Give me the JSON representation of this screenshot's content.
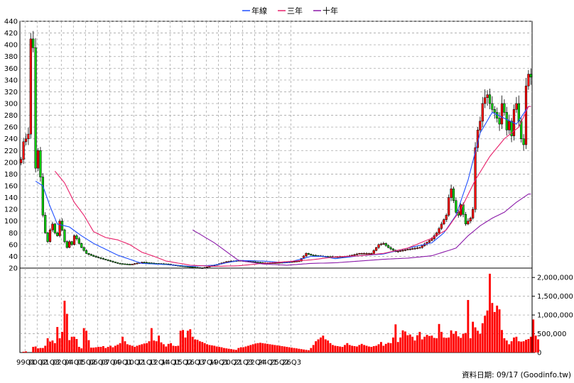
{
  "legend": [
    {
      "label": "年線",
      "color": "#1f4fff"
    },
    {
      "label": "三年",
      "color": "#e8206a"
    },
    {
      "label": "十年",
      "color": "#8a18a8"
    }
  ],
  "source_note": "資料日期: 09/17  (Goodinfo.tw)",
  "colors": {
    "up": "#ff0000",
    "down": "#00cc00",
    "volume": "#ff0000",
    "grid": "#a8a8a8",
    "frame": "#000000"
  },
  "chart_data": [
    {
      "type": "candlestick",
      "ylim": [
        20,
        440
      ],
      "yticks": [
        20,
        40,
        60,
        80,
        100,
        120,
        140,
        160,
        180,
        200,
        220,
        240,
        260,
        280,
        300,
        320,
        340,
        360,
        380,
        400,
        420,
        440
      ],
      "x_tick_labels": [
        "99Q1",
        "00Q2",
        "01Q3",
        "02Q4",
        "04Q1",
        "05Q2",
        "06Q3",
        "07Q4",
        "09Q1",
        "10Q2",
        "11Q3",
        "12Q4",
        "14Q1",
        "15Q2",
        "16Q3",
        "17Q4",
        "19Q1",
        "20Q2",
        "21Q3",
        "22Q4",
        "24Q1",
        "25Q2",
        "26Q3"
      ],
      "x_tick_every": 5,
      "grid": true,
      "legend_position": "top-center",
      "series": [
        {
          "name": "年線",
          "color": "#1f4fff",
          "x_start": 6,
          "y_start": 168,
          "anchors": [
            [
              6,
              168
            ],
            [
              9,
              160
            ],
            [
              12,
              125
            ],
            [
              15,
              95
            ],
            [
              20,
              90
            ],
            [
              25,
              75
            ],
            [
              30,
              62
            ],
            [
              40,
              42
            ],
            [
              50,
              28
            ],
            [
              60,
              26
            ],
            [
              70,
              23
            ],
            [
              80,
              25
            ],
            [
              90,
              33
            ],
            [
              100,
              32
            ],
            [
              110,
              29
            ],
            [
              120,
              40
            ],
            [
              125,
              40
            ],
            [
              130,
              36
            ],
            [
              140,
              41
            ],
            [
              150,
              44
            ],
            [
              160,
              54
            ],
            [
              170,
              63
            ],
            [
              175,
              80
            ],
            [
              180,
              110
            ],
            [
              185,
              170
            ],
            [
              190,
              250
            ],
            [
              195,
              285
            ],
            [
              200,
              275
            ],
            [
              205,
              265
            ],
            [
              210,
              295
            ]
          ]
        },
        {
          "name": "三年",
          "color": "#e8206a",
          "x_start": 14,
          "y_start": 185,
          "anchors": [
            [
              14,
              185
            ],
            [
              18,
              165
            ],
            [
              22,
              132
            ],
            [
              26,
              110
            ],
            [
              30,
              82
            ],
            [
              35,
              72
            ],
            [
              40,
              68
            ],
            [
              45,
              60
            ],
            [
              50,
              47
            ],
            [
              55,
              40
            ],
            [
              60,
              32
            ],
            [
              70,
              25
            ],
            [
              80,
              23
            ],
            [
              90,
              24
            ],
            [
              100,
              28
            ],
            [
              110,
              31
            ],
            [
              120,
              34
            ],
            [
              130,
              39
            ],
            [
              140,
              41
            ],
            [
              150,
              45
            ],
            [
              160,
              54
            ],
            [
              170,
              71
            ],
            [
              176,
              85
            ],
            [
              182,
              120
            ],
            [
              188,
              170
            ],
            [
              194,
              210
            ],
            [
              200,
              240
            ],
            [
              206,
              260
            ],
            [
              210,
              295
            ]
          ]
        },
        {
          "name": "十年",
          "color": "#8a18a8",
          "x_start": 71,
          "y_start": 85,
          "anchors": [
            [
              71,
              85
            ],
            [
              80,
              63
            ],
            [
              90,
              33
            ],
            [
              100,
              27
            ],
            [
              110,
              25
            ],
            [
              120,
              28
            ],
            [
              130,
              29
            ],
            [
              140,
              32
            ],
            [
              150,
              35
            ],
            [
              160,
              37
            ],
            [
              170,
              41
            ],
            [
              180,
              54
            ],
            [
              185,
              75
            ],
            [
              190,
              92
            ],
            [
              195,
              105
            ],
            [
              200,
              115
            ],
            [
              205,
              132
            ],
            [
              210,
              146
            ]
          ]
        }
      ],
      "candles": {
        "count": 212,
        "anchors": [
          [
            0,
            205
          ],
          [
            1,
            235
          ],
          [
            2,
            240
          ],
          [
            3,
            248
          ],
          [
            4,
            410
          ],
          [
            5,
            395
          ],
          [
            6,
            190
          ],
          [
            7,
            220
          ],
          [
            8,
            175
          ],
          [
            9,
            110
          ],
          [
            10,
            80
          ],
          [
            11,
            65
          ],
          [
            12,
            85
          ],
          [
            13,
            95
          ],
          [
            14,
            80
          ],
          [
            15,
            75
          ],
          [
            16,
            100
          ],
          [
            17,
            85
          ],
          [
            18,
            65
          ],
          [
            19,
            55
          ],
          [
            20,
            65
          ],
          [
            21,
            60
          ],
          [
            22,
            75
          ],
          [
            23,
            70
          ],
          [
            24,
            62
          ],
          [
            25,
            55
          ],
          [
            26,
            50
          ],
          [
            27,
            45
          ],
          [
            30,
            40
          ],
          [
            35,
            34
          ],
          [
            40,
            28
          ],
          [
            45,
            26
          ],
          [
            50,
            30
          ],
          [
            55,
            28
          ],
          [
            60,
            27
          ],
          [
            65,
            24
          ],
          [
            70,
            22
          ],
          [
            75,
            20
          ],
          [
            80,
            25
          ],
          [
            85,
            31
          ],
          [
            90,
            33
          ],
          [
            95,
            31
          ],
          [
            100,
            29
          ],
          [
            105,
            29
          ],
          [
            110,
            30
          ],
          [
            115,
            32
          ],
          [
            118,
            45
          ],
          [
            120,
            42
          ],
          [
            125,
            40
          ],
          [
            130,
            39
          ],
          [
            135,
            40
          ],
          [
            140,
            45
          ],
          [
            145,
            45
          ],
          [
            148,
            60
          ],
          [
            150,
            62
          ],
          [
            152,
            55
          ],
          [
            155,
            48
          ],
          [
            160,
            52
          ],
          [
            165,
            55
          ],
          [
            170,
            70
          ],
          [
            172,
            80
          ],
          [
            174,
            95
          ],
          [
            176,
            110
          ],
          [
            177,
            140
          ],
          [
            178,
            155
          ],
          [
            179,
            135
          ],
          [
            180,
            115
          ],
          [
            181,
            110
          ],
          [
            182,
            128
          ],
          [
            184,
            95
          ],
          [
            186,
            105
          ],
          [
            187,
            120
          ],
          [
            188,
            225
          ],
          [
            189,
            255
          ],
          [
            190,
            270
          ],
          [
            191,
            300
          ],
          [
            192,
            310
          ],
          [
            193,
            315
          ],
          [
            194,
            300
          ],
          [
            195,
            290
          ],
          [
            196,
            285
          ],
          [
            197,
            275
          ],
          [
            198,
            265
          ],
          [
            199,
            300
          ],
          [
            200,
            285
          ],
          [
            201,
            255
          ],
          [
            202,
            270
          ],
          [
            203,
            245
          ],
          [
            204,
            290
          ],
          [
            205,
            300
          ],
          [
            206,
            270
          ],
          [
            207,
            240
          ],
          [
            208,
            230
          ],
          [
            209,
            330
          ],
          [
            210,
            350
          ],
          [
            211,
            345
          ]
        ]
      }
    },
    {
      "type": "bar",
      "name": "volume",
      "ylim": [
        0,
        2250000
      ],
      "yticks": [
        0,
        500000,
        1000000,
        1500000,
        2000000
      ],
      "ytick_labels": [
        "0",
        "500,000",
        "1,000,000",
        "1,500,000",
        "2,000,000"
      ],
      "values": [
        0,
        20000,
        30000,
        0,
        0,
        150000,
        160000,
        110000,
        120000,
        120000,
        180000,
        380000,
        290000,
        320000,
        250000,
        680000,
        380000,
        550000,
        1380000,
        1030000,
        330000,
        420000,
        420000,
        360000,
        150000,
        110000,
        650000,
        580000,
        330000,
        130000,
        130000,
        140000,
        150000,
        150000,
        170000,
        120000,
        150000,
        180000,
        140000,
        180000,
        210000,
        250000,
        420000,
        300000,
        220000,
        200000,
        180000,
        150000,
        180000,
        200000,
        220000,
        240000,
        250000,
        300000,
        650000,
        320000,
        300000,
        450000,
        270000,
        220000,
        160000,
        230000,
        250000,
        180000,
        170000,
        180000,
        580000,
        600000,
        400000,
        580000,
        620000,
        420000,
        350000,
        340000,
        300000,
        280000,
        250000,
        220000,
        200000,
        190000,
        180000,
        160000,
        150000,
        140000,
        120000,
        110000,
        100000,
        90000,
        80000,
        70000,
        120000,
        140000,
        140000,
        160000,
        180000,
        200000,
        220000,
        240000,
        250000,
        260000,
        250000,
        240000,
        230000,
        220000,
        210000,
        200000,
        190000,
        180000,
        170000,
        160000,
        150000,
        140000,
        130000,
        120000,
        110000,
        100000,
        90000,
        80000,
        70000,
        60000,
        120000,
        200000,
        300000,
        350000,
        400000,
        450000,
        350000,
        320000,
        250000,
        200000,
        180000,
        170000,
        160000,
        150000,
        200000,
        250000,
        200000,
        180000,
        170000,
        160000,
        200000,
        230000,
        200000,
        180000,
        160000,
        150000,
        170000,
        180000,
        220000,
        280000,
        180000,
        230000,
        260000,
        250000,
        400000,
        750000,
        280000,
        400000,
        590000,
        560000,
        460000,
        480000,
        420000,
        320000,
        460000,
        550000,
        350000,
        420000,
        470000,
        440000,
        450000,
        390000,
        380000,
        760000,
        550000,
        400000,
        390000,
        400000,
        590000,
        500000,
        570000,
        430000,
        390000,
        500000,
        520000,
        1400000,
        380000,
        820000,
        670000,
        580000,
        500000,
        780000,
        980000,
        1120000,
        2100000,
        1320000,
        1080000,
        1250000,
        1150000,
        600000,
        380000,
        320000,
        220000,
        300000,
        400000,
        420000,
        300000,
        290000,
        300000,
        340000,
        360000,
        420000,
        880000,
        450000,
        350000
      ]
    }
  ]
}
